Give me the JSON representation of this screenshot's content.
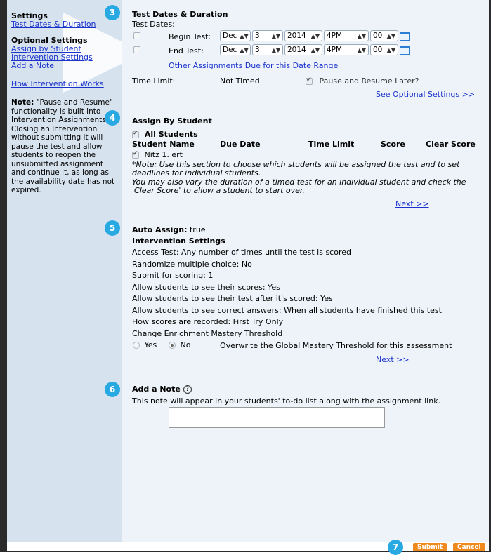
{
  "sidebar": {
    "settings_heading": "Settings",
    "settings_link": "Test Dates & Duration",
    "optional_heading": "Optional Settings",
    "optional_links": [
      "Assign by Student",
      "Intervention Settings",
      "Add a Note"
    ],
    "how_link": "How Intervention Works",
    "note_label": "Note:",
    "note_body": "\"Pause and Resume\" functionality is built into Intervention Assignments. Closing an Intervention without submitting it will pause the test and allow students to reopen the unsubmitted assignment and continue it, as long as the availability date has not expired."
  },
  "badges": [
    "3",
    "4",
    "5",
    "6",
    "7"
  ],
  "dates": {
    "title": "Test Dates & Duration",
    "subtitle": "Test Dates:",
    "begin_label": "Begin Test:",
    "end_label": "End Test:",
    "begin": {
      "month": "Dec",
      "day": "3",
      "year": "2014",
      "hour": "4PM",
      "minute": "00"
    },
    "end": {
      "month": "Dec",
      "day": "3",
      "year": "2014",
      "hour": "4PM",
      "minute": "00"
    },
    "other_link": "Other Assignments Due for this Date Range",
    "time_limit_label": "Time Limit:",
    "time_limit_value": "Not Timed",
    "pause_label": "Pause and Resume Later?",
    "optional_link": "See Optional Settings >>"
  },
  "assign": {
    "title": "Assign By Student",
    "all_students": "All Students",
    "columns": [
      "Student Name",
      "Due Date",
      "Time Limit",
      "Score",
      "Clear Score"
    ],
    "student": "Nitz 1. ert",
    "note1": "*Note: Use this section to choose which students will be assigned the test and to set deadlines for individual students.",
    "note2": "You may also vary the duration of a timed test for an individual student and check the 'Clear Score' to allow a student to start over.",
    "next": "Next >>"
  },
  "intervention": {
    "auto_assign_label": "Auto Assign:",
    "auto_assign_value": "true",
    "title": "Intervention Settings",
    "lines": [
      "Access Test: Any number of times until the test is scored",
      "Randomize multiple choice:  No",
      "Submit for scoring:  1",
      "Allow students to see their scores:  Yes",
      "Allow students to see their test after it's scored:  Yes",
      "Allow students to see correct answers:  When all students have finished this test",
      "How scores are recorded:  First Try Only",
      "Change Enrichment Mastery Threshold"
    ],
    "yes": "Yes",
    "no": "No",
    "overwrite": "Overwrite the Global Mastery Threshold for this assessment",
    "next": "Next >>"
  },
  "note": {
    "title": "Add a Note",
    "help": "?",
    "description": "This note will appear in your students' to-do list along with the assignment link."
  },
  "footer": {
    "submit": "Submit",
    "cancel": "Cancel"
  }
}
